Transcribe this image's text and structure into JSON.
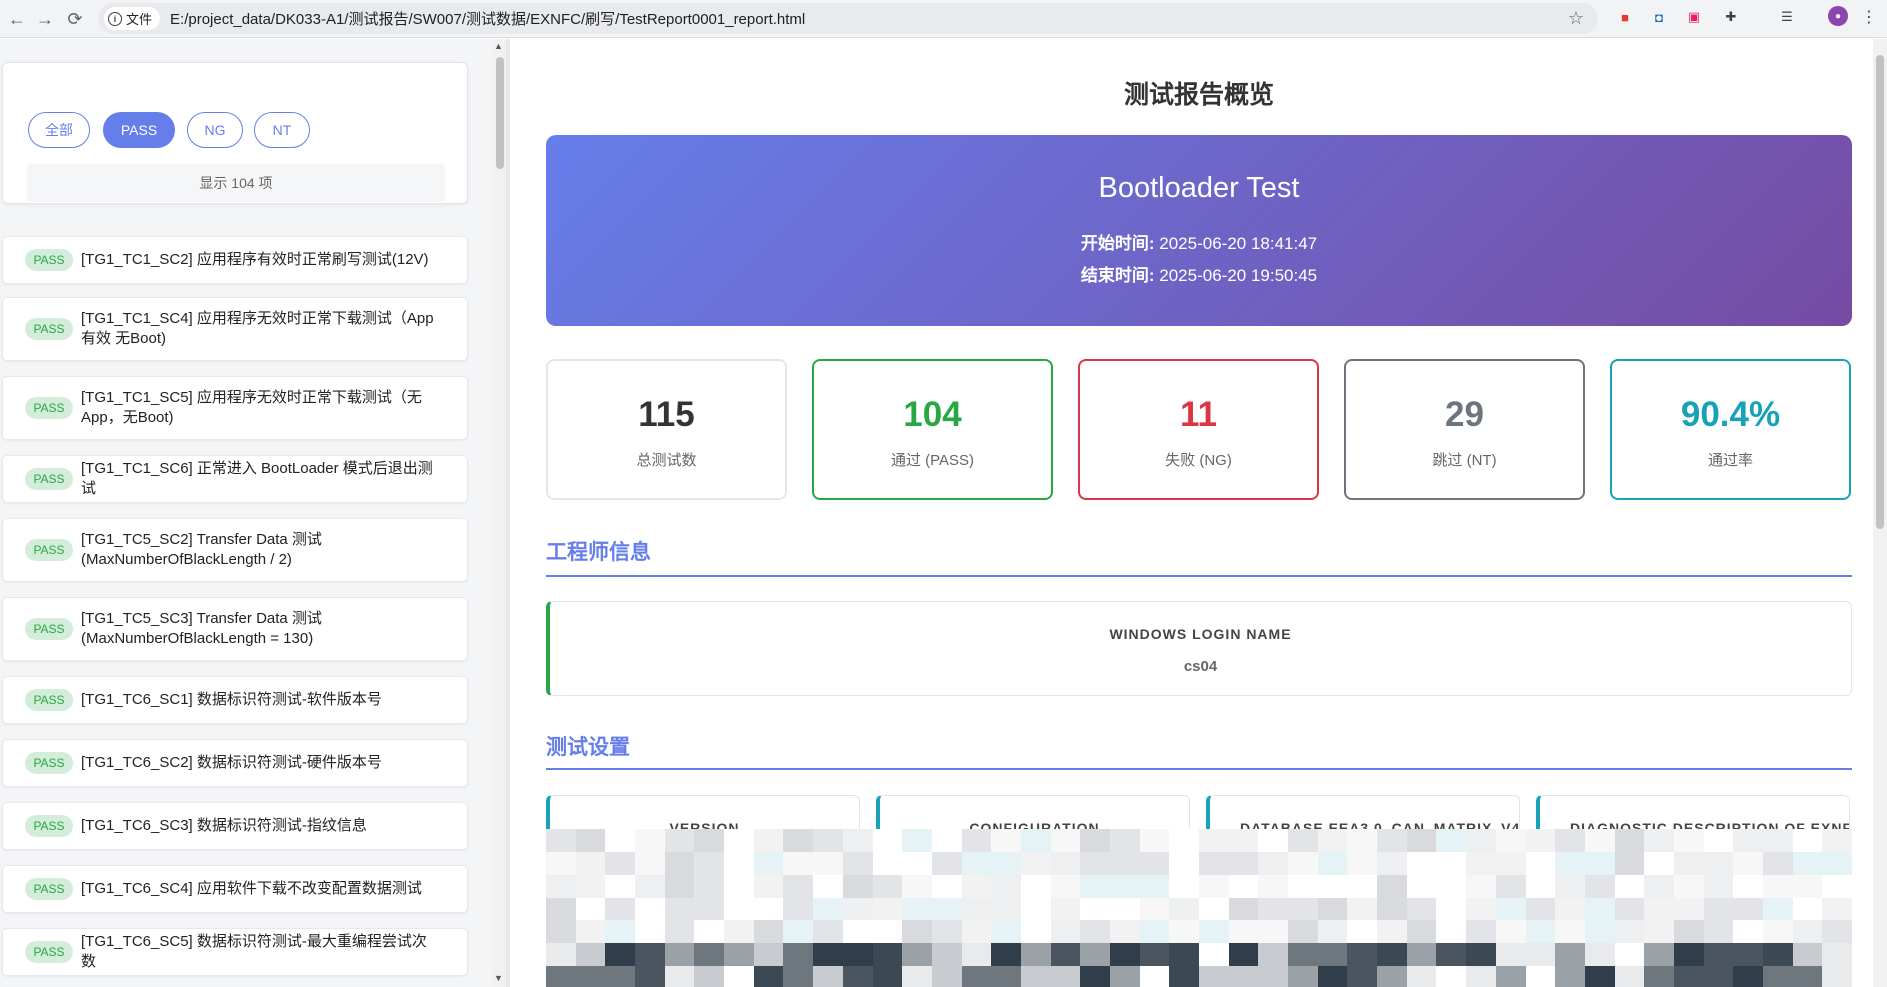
{
  "browser": {
    "file_chip": "文件",
    "url": "E:/project_data/DK033-A1/测试报告/SW007/测试数据/EXNFC/刷写/TestReport0001_report.html"
  },
  "sidebar": {
    "filters": [
      "全部",
      "PASS",
      "NG",
      "NT"
    ],
    "active_filter": "PASS",
    "count_text": "显示 104 项",
    "items": [
      {
        "status": "PASS",
        "text": "[TG1_TC1_SC2] 应用程序有效时正常刷写测试(12V)"
      },
      {
        "status": "PASS",
        "text": "[TG1_TC1_SC4] 应用程序无效时正常下载测试（App有效 无Boot)"
      },
      {
        "status": "PASS",
        "text": "[TG1_TC1_SC5] 应用程序无效时正常下载测试（无App，无Boot)"
      },
      {
        "status": "PASS",
        "text": "[TG1_TC1_SC6] 正常进入 BootLoader 模式后退出测试"
      },
      {
        "status": "PASS",
        "text": "[TG1_TC5_SC2] Transfer Data 测试 (MaxNumberOfBlackLength / 2)"
      },
      {
        "status": "PASS",
        "text": "[TG1_TC5_SC3] Transfer Data 测试 (MaxNumberOfBlackLength = 130)"
      },
      {
        "status": "PASS",
        "text": "[TG1_TC6_SC1] 数据标识符测试-软件版本号"
      },
      {
        "status": "PASS",
        "text": "[TG1_TC6_SC2] 数据标识符测试-硬件版本号"
      },
      {
        "status": "PASS",
        "text": "[TG1_TC6_SC3] 数据标识符测试-指纹信息"
      },
      {
        "status": "PASS",
        "text": "[TG1_TC6_SC4] 应用软件下载不改变配置数据测试"
      },
      {
        "status": "PASS",
        "text": "[TG1_TC6_SC5] 数据标识符测试-最大重编程尝试次数"
      }
    ]
  },
  "main": {
    "page_title": "测试报告概览",
    "hero": {
      "title": "Bootloader Test",
      "start_label": "开始时间:",
      "start_value": "2025-06-20 18:41:47",
      "end_label": "结束时间:",
      "end_value": "2025-06-20 19:50:45"
    },
    "stats": [
      {
        "value": "115",
        "label": "总测试数",
        "color": "#333333",
        "border": "#e6e6e6"
      },
      {
        "value": "104",
        "label": "通过 (PASS)",
        "color": "#28a745",
        "border": "#28a745"
      },
      {
        "value": "11",
        "label": "失败 (NG)",
        "color": "#dc3545",
        "border": "#dc3545"
      },
      {
        "value": "29",
        "label": "跳过 (NT)",
        "color": "#6c757d",
        "border": "#6c757d"
      },
      {
        "value": "90.4%",
        "label": "通过率",
        "color": "#17a2b8",
        "border": "#17a2b8"
      }
    ],
    "engineer": {
      "section_title": "工程师信息",
      "key": "WINDOWS LOGIN NAME",
      "value": "cs04"
    },
    "settings": {
      "section_title": "测试设置",
      "cards": [
        "VERSION",
        "CONFIGURATION",
        "DATABASE EEA3.0_CAN_MATRIX_V4.",
        "DIAGNOSTIC DESCRIPTION OF EXNF"
      ]
    }
  },
  "colors": {
    "accent": "#667eea",
    "gradient_end": "#764ba2",
    "pass": "#28a745",
    "ng": "#dc3545",
    "nt": "#6c757d",
    "rate": "#17a2b8"
  }
}
